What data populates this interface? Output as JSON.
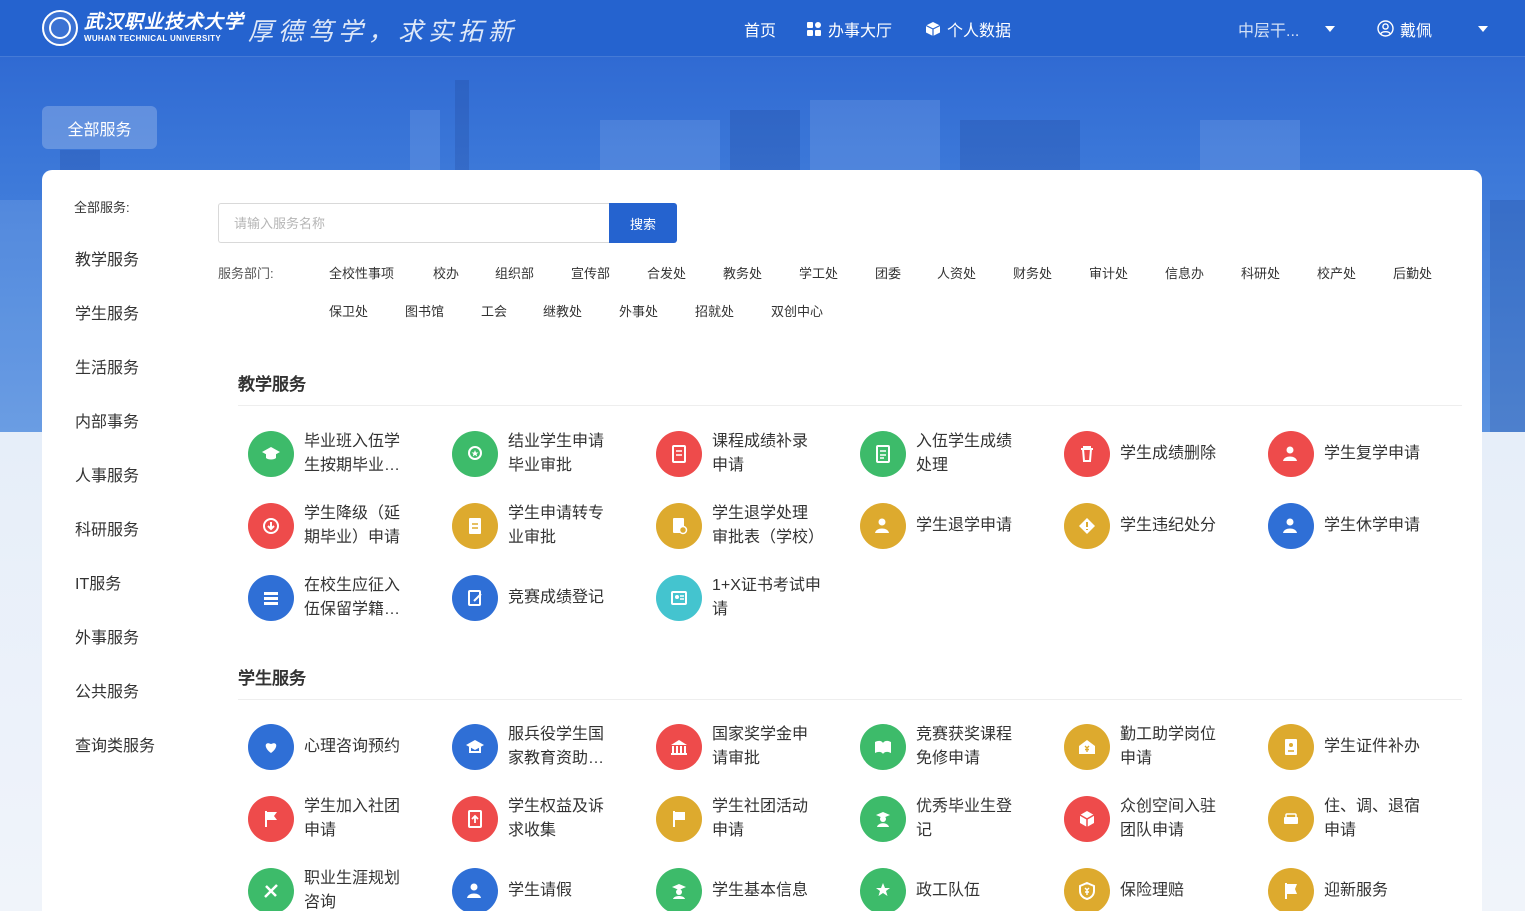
{
  "header": {
    "logo_cn": "武汉职业技术大学",
    "logo_en": "WUHAN TECHNICAL UNIVERSITY",
    "motto": "厚德笃学，求实拓新",
    "nav": {
      "home": "首页",
      "hall": "办事大厅",
      "personal": "个人数据"
    },
    "role": "中层干...",
    "user": "戴佩"
  },
  "tab_all": "全部服务",
  "sidebar": {
    "title": "全部服务:",
    "items": [
      "教学服务",
      "学生服务",
      "生活服务",
      "内部事务",
      "人事服务",
      "科研服务",
      "IT服务",
      "外事服务",
      "公共服务",
      "查询类服务"
    ]
  },
  "search": {
    "placeholder": "请输入服务名称",
    "value": "",
    "button": "搜索"
  },
  "departments": {
    "label": "服务部门:",
    "row1": [
      "全校性事项",
      "校办",
      "组织部",
      "宣传部",
      "合发处",
      "教务处",
      "学工处",
      "团委",
      "人资处",
      "财务处",
      "审计处",
      "信息办",
      "科研处",
      "校产处",
      "后勤处"
    ],
    "row2": [
      "保卫处",
      "图书馆",
      "工会",
      "继教处",
      "外事处",
      "招就处",
      "双创中心"
    ]
  },
  "sections": [
    {
      "title": "教学服务",
      "services": [
        {
          "label": "毕业班入伍学生按期毕业申请",
          "color": "green",
          "icon": "graduation-cap-icon"
        },
        {
          "label": "结业学生申请毕业审批",
          "color": "green",
          "icon": "badge-icon"
        },
        {
          "label": "课程成绩补录申请",
          "color": "red",
          "icon": "book-icon"
        },
        {
          "label": "入伍学生成绩处理",
          "color": "green",
          "icon": "grade-sheet-icon"
        },
        {
          "label": "学生成绩删除",
          "color": "red",
          "icon": "trash-icon"
        },
        {
          "label": "学生复学申请",
          "color": "red",
          "icon": "user-return-icon"
        },
        {
          "label": "学生降级（延期毕业）申请",
          "color": "red",
          "icon": "arrow-down-icon"
        },
        {
          "label": "学生申请转专业审批",
          "color": "gold",
          "icon": "document-icon"
        },
        {
          "label": "学生退学处理审批表（学校）",
          "color": "gold",
          "icon": "form-clock-icon"
        },
        {
          "label": "学生退学申请",
          "color": "gold",
          "icon": "user-remove-icon"
        },
        {
          "label": "学生违纪处分",
          "color": "gold",
          "icon": "warning-icon"
        },
        {
          "label": "学生休学申请",
          "color": "blue",
          "icon": "user-pause-icon"
        },
        {
          "label": "在校生应征入伍保留学籍申请",
          "color": "blue",
          "icon": "stack-icon"
        },
        {
          "label": "竞赛成绩登记",
          "color": "blue",
          "icon": "edit-icon"
        },
        {
          "label": "1+X证书考试申请",
          "color": "teal",
          "icon": "certificate-icon"
        }
      ]
    },
    {
      "title": "学生服务",
      "services": [
        {
          "label": "心理咨询预约",
          "color": "blue",
          "icon": "heart-hand-icon"
        },
        {
          "label": "服兵役学生国家教育资助申请",
          "color": "blue",
          "icon": "cap-icon"
        },
        {
          "label": "国家奖学金申请审批",
          "color": "red",
          "icon": "building-icon"
        },
        {
          "label": "竞赛获奖课程免修申请",
          "color": "green",
          "icon": "open-book-icon"
        },
        {
          "label": "勤工助学岗位申请",
          "color": "gold",
          "icon": "yuan-house-icon"
        },
        {
          "label": "学生证件补办",
          "color": "gold",
          "icon": "id-card-icon"
        },
        {
          "label": "学生加入社团申请",
          "color": "red",
          "icon": "flag-icon"
        },
        {
          "label": "学生权益及诉求收集",
          "color": "red",
          "icon": "upload-doc-icon"
        },
        {
          "label": "学生社团活动申请",
          "color": "gold",
          "icon": "banner-icon"
        },
        {
          "label": "优秀毕业生登记",
          "color": "green",
          "icon": "graduate-icon"
        },
        {
          "label": "众创空间入驻团队申请",
          "color": "red",
          "icon": "cube-icon"
        },
        {
          "label": "住、调、退宿申请",
          "color": "gold",
          "icon": "bed-icon"
        },
        {
          "label": "职业生涯规划咨询",
          "color": "green",
          "icon": "tools-icon"
        },
        {
          "label": "学生请假",
          "color": "blue",
          "icon": "user-clock-icon"
        },
        {
          "label": "学生基本信息",
          "color": "green",
          "icon": "student-icon"
        },
        {
          "label": "政工队伍",
          "color": "green",
          "icon": "star-group-icon"
        },
        {
          "label": "保险理赔",
          "color": "gold",
          "icon": "yuan-shield-icon"
        },
        {
          "label": "迎新服务",
          "color": "gold",
          "icon": "welcome-flag-icon"
        }
      ]
    }
  ]
}
